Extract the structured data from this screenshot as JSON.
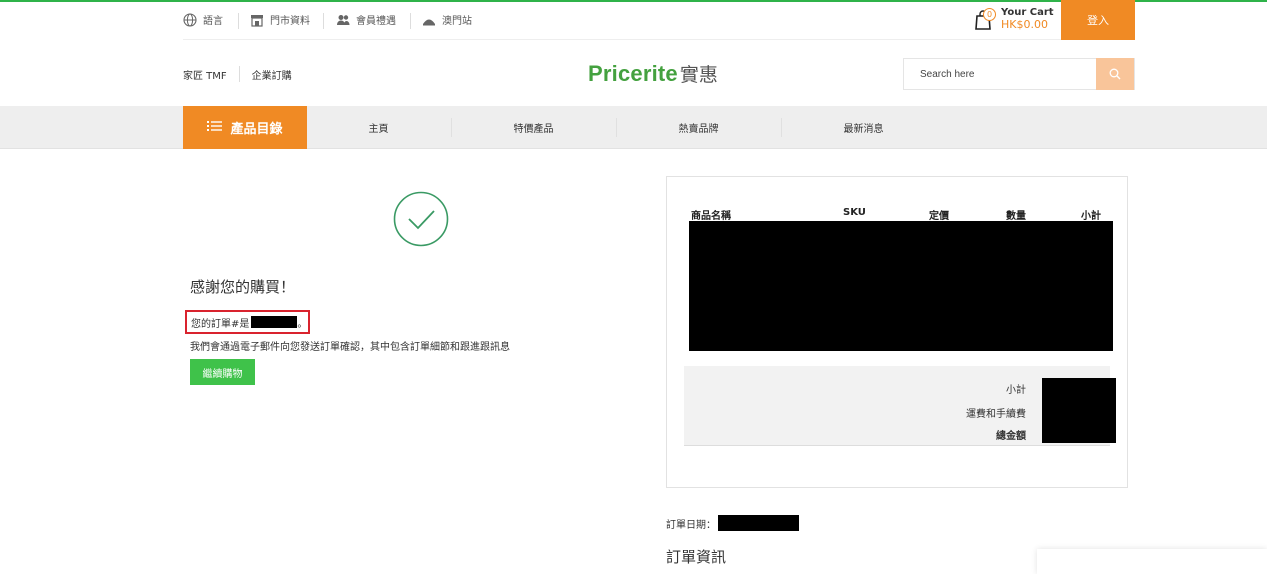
{
  "utility_bar": {
    "language": "語言",
    "store_info": "門市資料",
    "member_benefits": "會員禮遇",
    "macau_site": "澳門站",
    "cart": {
      "count": "0",
      "label": "Your Cart",
      "amount": "HK$0.00"
    },
    "login": "登入"
  },
  "header": {
    "corp_links": [
      "家匠 TMF",
      "企業訂購"
    ],
    "logo": {
      "en": "Pricerite",
      "zh": "實惠"
    },
    "search": {
      "placeholder": "Search here",
      "value": ""
    }
  },
  "nav": {
    "category_label": "產品目錄",
    "items": [
      "主頁",
      "特價產品",
      "熱賣品牌",
      "最新消息"
    ]
  },
  "confirmation": {
    "thanks": "感謝您的購買！",
    "order_prefix": "您的訂單#是",
    "order_suffix": "。",
    "email_note": "我們會通過電子郵件向您發送訂單確認，其中包含訂單細節和跟進跟訊息",
    "continue_button": "繼續購物"
  },
  "order_summary": {
    "columns": [
      "商品名稱",
      "SKU",
      "定價",
      "數量",
      "小計"
    ],
    "totals_labels": [
      "小計",
      "運費和手續費",
      "總金額"
    ]
  },
  "order_details": {
    "date_label": "訂單日期：",
    "info_heading": "訂單資訊"
  },
  "colors": {
    "accent_orange": "#f08a24",
    "brand_green": "#44a13f",
    "success_green": "#3fc24a",
    "highlight_red": "#d9232e"
  }
}
